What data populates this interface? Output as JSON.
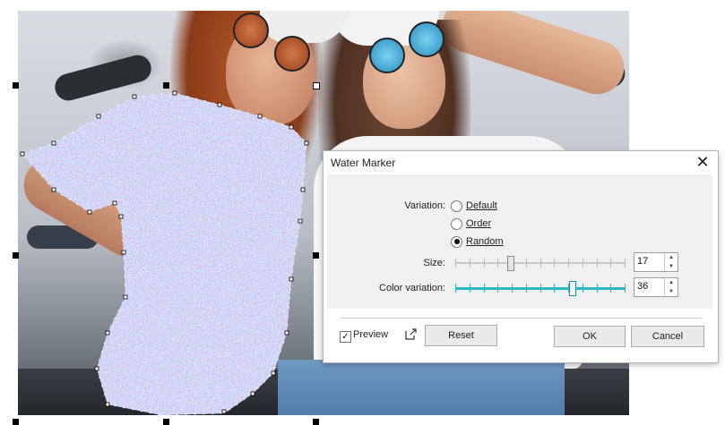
{
  "dialog": {
    "title": "Water Marker",
    "close_icon": "close-icon",
    "variation_label": "Variation:",
    "variation_options": [
      {
        "label": "Default",
        "selected": false
      },
      {
        "label": "Order",
        "selected": false
      },
      {
        "label": "Random",
        "selected": true
      }
    ],
    "size_label": "Size:",
    "size_value": "17",
    "size_fraction": 0.32,
    "color_variation_label": "Color variation:",
    "color_variation_value": "36",
    "color_variation_fraction": 0.7,
    "preview_label": "Preview",
    "preview_checked": true,
    "popout_icon": "popout-icon",
    "reset_label": "Reset",
    "ok_label": "OK",
    "cancel_label": "Cancel"
  },
  "canvas": {
    "effect_color": "#7b80e0",
    "slider_accent": "#2fb6c4"
  }
}
